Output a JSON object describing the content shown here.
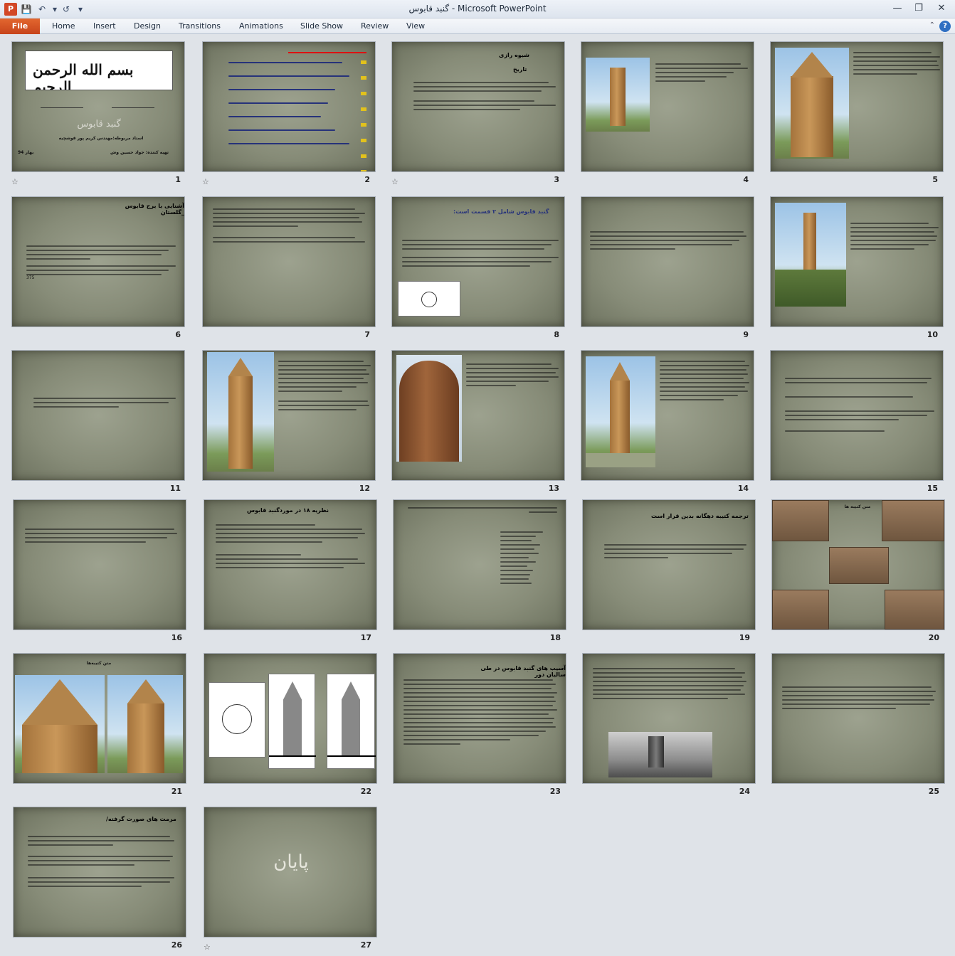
{
  "window": {
    "title": "گنبد قابوس  -  Microsoft PowerPoint",
    "app_icon_letter": "P"
  },
  "ribbon": {
    "file_tab": "File",
    "tabs": [
      "Home",
      "Insert",
      "Design",
      "Transitions",
      "Animations",
      "Slide Show",
      "Review",
      "View"
    ]
  },
  "slides": [
    {
      "number": "1",
      "title": "گنبد قابوس",
      "teacher": "استاد مربوطه:مهندس کریم پور قوشچیه",
      "author": "تهیه کننده: جواد حسین وش",
      "season": "بهار 94",
      "calligraphy": "بسم الله الرحمن الرحیم"
    },
    {
      "number": "2"
    },
    {
      "number": "3",
      "heading": "شیوه رازی",
      "subheading": "تاریخ"
    },
    {
      "number": "4"
    },
    {
      "number": "5"
    },
    {
      "number": "6",
      "heading": "آشنایی با برج قابوس _گلستان",
      "year_text": "375"
    },
    {
      "number": "7"
    },
    {
      "number": "8",
      "heading": "گنبد قابوس شامل ۲ قسمت است:"
    },
    {
      "number": "9"
    },
    {
      "number": "10"
    },
    {
      "number": "11"
    },
    {
      "number": "12"
    },
    {
      "number": "13"
    },
    {
      "number": "14"
    },
    {
      "number": "15"
    },
    {
      "number": "16"
    },
    {
      "number": "17",
      "heading": "نظریه ۱۸ در موردگنبد  قابوس"
    },
    {
      "number": "18"
    },
    {
      "number": "19",
      "heading": "ترجمه کتیبه دهگانه بدین قرار است"
    },
    {
      "number": "20",
      "heading": "متن کتیبه ها"
    },
    {
      "number": "21",
      "heading": "متن کتیبه‌ها"
    },
    {
      "number": "22"
    },
    {
      "number": "23",
      "heading": "آسیب های گنبد قابوس در طی سالیان دور"
    },
    {
      "number": "24"
    },
    {
      "number": "25"
    },
    {
      "number": "26",
      "heading": "مرمت های صورت گرفته/"
    },
    {
      "number": "27",
      "title": "پایان"
    }
  ]
}
